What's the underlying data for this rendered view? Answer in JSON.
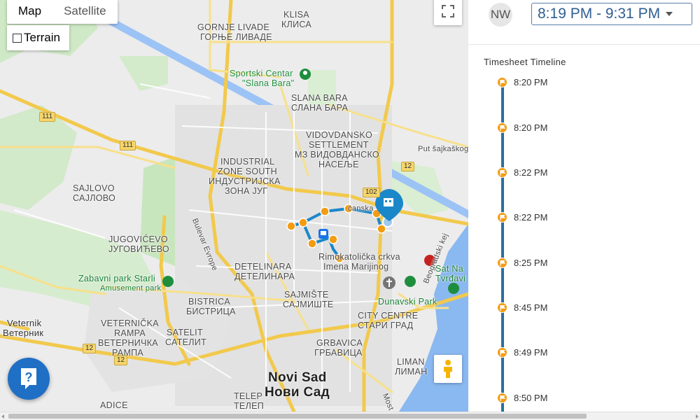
{
  "map": {
    "type_options": [
      {
        "label": "Map",
        "active": true
      },
      {
        "label": "Satellite",
        "active": false
      }
    ],
    "terrain_label": "Terrain",
    "labels": {
      "gornje_livade": "GORNJE LIVADE",
      "gornje_livade_cyr": "ГОРЊЕ ЛИВАДЕ",
      "klisa": "KLISA",
      "klisa_cyr": "КЛИСА",
      "sportski_centar": "Sportski Centar",
      "slana_bara_quoted": "\"Slana Bara\"",
      "slana_bara": "SLANA BARA",
      "slana_bara_cyr": "СЛАНА БАРА",
      "vidovdansko": "VIDOVDANSKO",
      "settlement": "SETTLEMENT",
      "vidovdansko_cyr": "МЗ ВИДОВДАНСКО",
      "naselje_cyr": "НАСЕЉЕ",
      "put_sajkaskog": "Put šajkaškog o",
      "industrial": "INDUSTRIAL",
      "zone_south": "ZONE SOUTH",
      "industrijska_cyr": "ИНДУСТРИЈСКА",
      "zona_jug_cyr": "ЗОНА ЈУГ",
      "sajlovo": "SAJLOVO",
      "sajlovo_cyr": "САЈЛОВО",
      "jugovicevo": "JUGOVIĆEVO",
      "jugovicevo_cyr": "ЈУГОВИЋЕВО",
      "bulevar_evrope": "Bulevar Evrope",
      "stanka": "ćanska",
      "rimokatolicka": "Rimokatolička crkva",
      "imena_marijinog": "Imena Marijinog",
      "beogradski_kej": "Beogradski kej",
      "sat_na": "Sat Na",
      "tvrdavi": "Tvrđavi",
      "zabavni_park": "Zabavni park Starli",
      "amusement_park": "Amusement park",
      "detelinara": "DETELINARA",
      "detelinara_cyr": "ДЕТЕЛИНАРА",
      "bistrica": "BISTRICA",
      "bistrica_cyr": "БИСТРИЦА",
      "sajmiste": "SAJMIŠTE",
      "sajmiste_cyr": "САЈМИШТЕ",
      "dunavski_park": "Dunavski Park",
      "city_centre": "CITY CENTRE",
      "stari_grad_cyr": "СТАРИ ГРАД",
      "veternik": "Veternik",
      "veternik_cyr": "Ветерник",
      "veternicka": "VETERNIČKA",
      "rampa": "RAMPA",
      "veternicka_cyr": "ВЕТЕРНИЧКА",
      "rampa_cyr": "РАМПА",
      "satelit": "SATELIT",
      "satelit_cyr": "САТЕЛИТ",
      "grbavica": "GRBAVICA",
      "grbavica_cyr": "ГРБАВИЦА",
      "liman": "LIMAN",
      "liman_cyr": "ЛИМАН",
      "novi_sad": "Novi Sad",
      "novi_sad_cyr": "Нови Сад",
      "telep": "TELEP",
      "telep_cyr": "ТЕЛЕП",
      "adice": "ADICE",
      "mostar": "Most"
    },
    "road_shields": [
      "111",
      "111",
      "102",
      "12",
      "12",
      "12"
    ]
  },
  "panel": {
    "avatar_initials": "NW",
    "time_range": "8:19 PM - 9:31 PM",
    "timeline_title": "Timesheet Timeline",
    "entries": [
      {
        "time": "8:20 PM"
      },
      {
        "time": "8:20 PM"
      },
      {
        "time": "8:22 PM"
      },
      {
        "time": "8:22 PM"
      },
      {
        "time": "8:25 PM"
      },
      {
        "time": "8:45 PM"
      },
      {
        "time": "8:49 PM"
      },
      {
        "time": "8:50 PM"
      }
    ]
  },
  "colors": {
    "accent_blue": "#2f5f93",
    "route_blue": "#1a87c9",
    "marker_orange": "#f39c12",
    "help_blue": "#1f6fc5"
  }
}
